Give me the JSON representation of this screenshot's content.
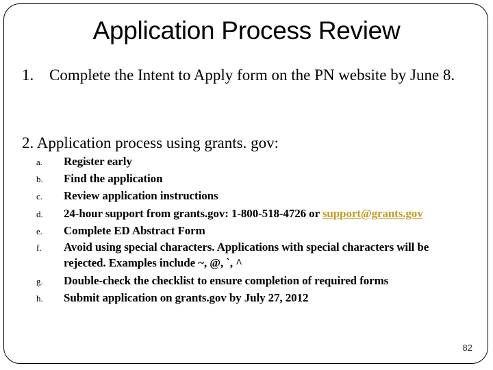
{
  "slide": {
    "title": "Application Process Review",
    "page_number": "82"
  },
  "items": [
    {
      "number": "1.",
      "text": "Complete the Intent to Apply form on the PN website by June 8."
    },
    {
      "number": "2.",
      "text": "Application process using grants. gov:",
      "subitems": [
        {
          "letter": "a.",
          "text": "Register early"
        },
        {
          "letter": "b.",
          "text": "Find the application"
        },
        {
          "letter": "c.",
          "text": "Review application instructions"
        },
        {
          "letter": "d.",
          "text_before_link": "24-hour support from grants.gov: 1-800-518-4726 or ",
          "link_text": "support@grants.gov"
        },
        {
          "letter": "e.",
          "text": "Complete ED Abstract Form"
        },
        {
          "letter": "f.",
          "text_line1": "Avoid using special characters.  Applications with special characters will be",
          "text_line2": "rejected.  Examples include  ~, @, `, ^"
        },
        {
          "letter": "g.",
          "text": "Double-check the checklist to ensure completion of required forms"
        },
        {
          "letter": "h.",
          "text": "Submit application on grants.gov by July 27, 2012"
        }
      ]
    }
  ],
  "colors": {
    "link": "#c49a1c",
    "border": "#000000"
  }
}
